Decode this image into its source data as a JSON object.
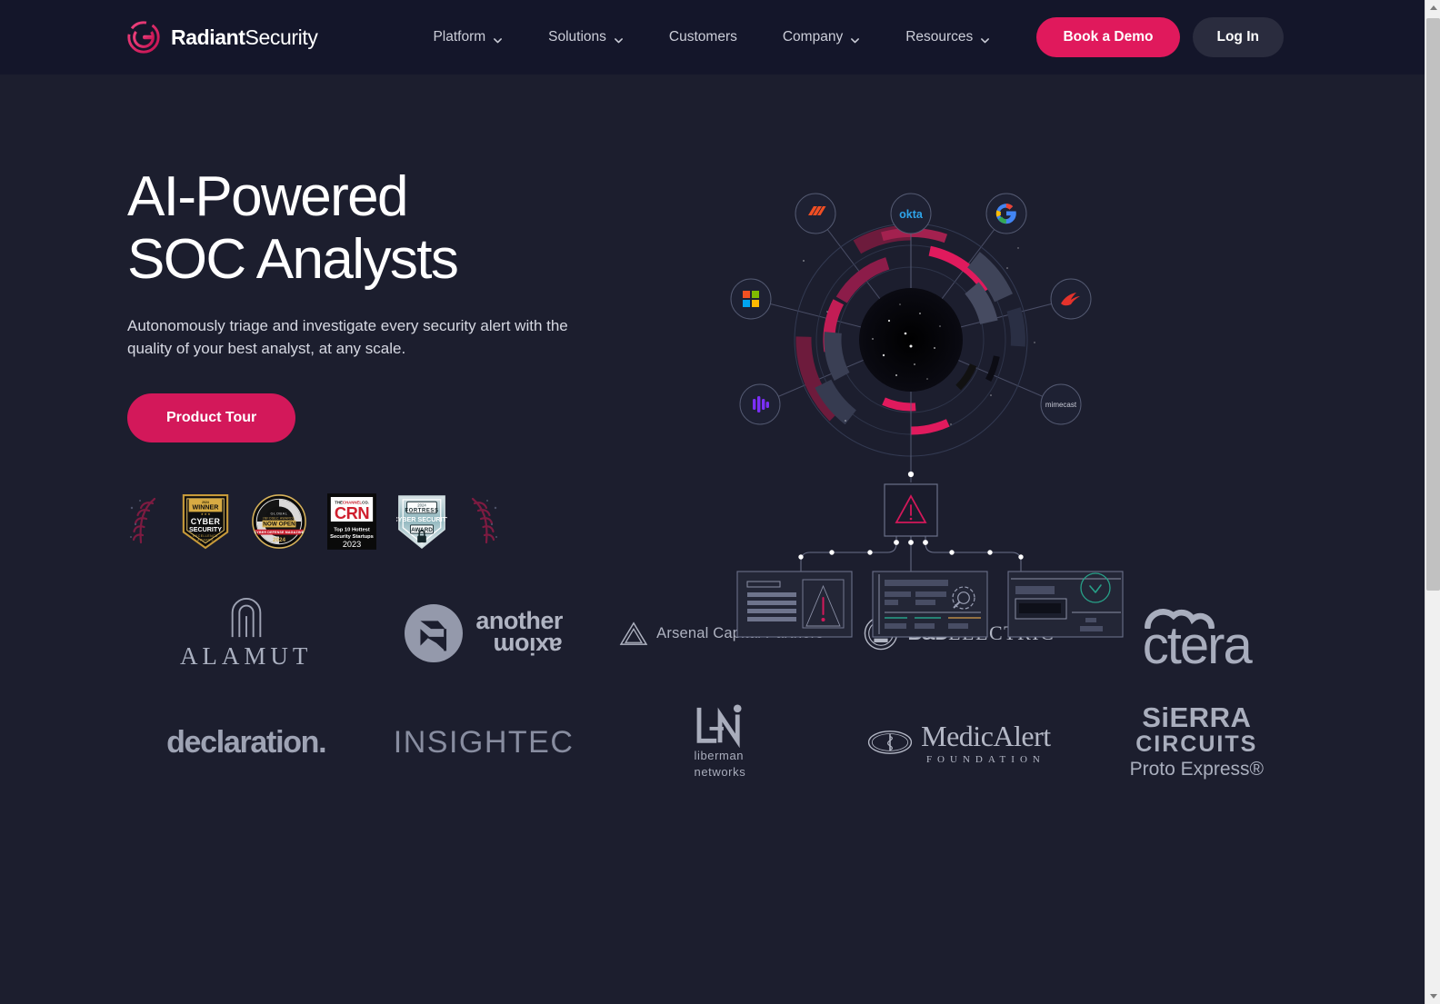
{
  "brand": {
    "name_bold": "Radiant",
    "name_light": "Security",
    "logo_icon": "radiant-circular-logo-icon"
  },
  "nav": {
    "items": [
      {
        "label": "Platform",
        "has_dropdown": true
      },
      {
        "label": "Solutions",
        "has_dropdown": true
      },
      {
        "label": "Customers",
        "has_dropdown": false
      },
      {
        "label": "Company",
        "has_dropdown": true
      },
      {
        "label": "Resources",
        "has_dropdown": true
      }
    ],
    "demo_button": "Book a Demo",
    "login_button": "Log In"
  },
  "hero": {
    "headline_line1": "AI-Powered",
    "headline_line2": "SOC Analysts",
    "subhead": "Autonomously triage and investigate every security alert with the quality of your best analyst, at any scale.",
    "cta": "Product Tour"
  },
  "awards": {
    "left_laurel": "laurel-wreath-icon",
    "right_laurel": "laurel-wreath-icon",
    "badges": [
      {
        "id": "cyber-security-excellence-awards-badge",
        "year": "2024",
        "line1": "WINNER",
        "line2": "CYBER",
        "line3": "SECURITY",
        "line4": "EXCELLENCE",
        "line5": "AWARDS"
      },
      {
        "id": "global-infosec-awards-badge",
        "line1": "GLOBAL",
        "line2": "INFOSEC AWARDS",
        "line3": "NOW OPEN",
        "line4": "CYBER DEFENSE MAGAZINE",
        "year": "2024"
      },
      {
        "id": "crn-top-10-hottest-security-startups-badge",
        "line1": "THE CHANNEL CO.",
        "line2": "CRN",
        "line3": "Top 10 Hottest",
        "line4": "Security Startups",
        "year": "2023"
      },
      {
        "id": "fortress-cyber-security-award-badge",
        "year": "2024",
        "line1": "FORTRESS",
        "line2": "CYBER SECURITY",
        "line3": "AWARD"
      }
    ]
  },
  "hero_graphic": {
    "center_label": "radial-security-hub",
    "integrations": [
      {
        "name": "palo-alto-networks",
        "label": "",
        "color": "#f04e23"
      },
      {
        "name": "okta",
        "label": "okta",
        "color": "#1c7fd6"
      },
      {
        "name": "google",
        "label": "G",
        "color": "#4285f4"
      },
      {
        "name": "crowdstrike",
        "label": "",
        "color": "#e4322b"
      },
      {
        "name": "mimecast",
        "label": "mimecast",
        "color": "#c9cbd6"
      },
      {
        "name": "splunk",
        "label": "",
        "color": "#7b2ff7"
      },
      {
        "name": "microsoft",
        "label": "",
        "color": "#f25022"
      }
    ],
    "alert_node": "alert-warning-triangle",
    "output_cards": [
      {
        "name": "alert-detail-card",
        "icon": "warning-triangle-icon"
      },
      {
        "name": "investigation-card",
        "icon": "gear-magnifier-icon"
      },
      {
        "name": "resolution-card",
        "icon": "check-circle-icon"
      }
    ]
  },
  "customers": {
    "logos": [
      {
        "name": "alamut-logo",
        "text": "ALAMUT"
      },
      {
        "name": "another-axiom-logo",
        "text_top": "another",
        "text_bottom": "axiom"
      },
      {
        "name": "arsenal-capital-partners-logo",
        "text": "Arsenal Capital Partners"
      },
      {
        "name": "bd-electric-logo",
        "text_bold": "B&D",
        "text": "ELECTRIC"
      },
      {
        "name": "ctera-logo",
        "text": "ctera"
      },
      {
        "name": "declaration-logo",
        "text": "declaration."
      },
      {
        "name": "insightec-logo",
        "text": "INSIGHTEC"
      },
      {
        "name": "liberman-networks-logo",
        "text_mark": "LN",
        "text_line1": "liberman",
        "text_line2": "networks"
      },
      {
        "name": "medicalert-foundation-logo",
        "text": "MedicAlert",
        "text_sub": "FOUNDATION"
      },
      {
        "name": "sierra-circuits-logo",
        "text_line1": "SiERRA",
        "text_line2": "CIRCUITS",
        "text_line3": "Proto Express®"
      }
    ]
  },
  "colors": {
    "page_background": "#1c1e2e",
    "header_background": "#14162a",
    "accent_pink": "#d3185a",
    "demo_button": "#e0195c",
    "login_button": "#2a2c3e",
    "body_text": "#d6d8e2",
    "logo_gray": "#a6aab9"
  }
}
